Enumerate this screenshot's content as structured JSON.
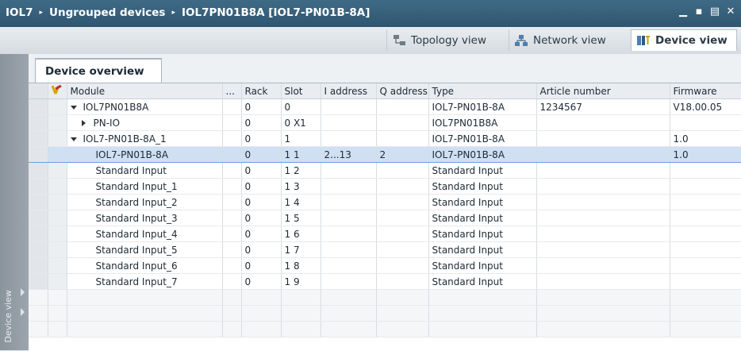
{
  "titlebar": {
    "crumbs": [
      "IOL7",
      "Ungrouped devices",
      "IOL7PN01B8A [IOL7-PN01B-8A]"
    ],
    "separator": "▸"
  },
  "views": {
    "topology": "Topology view",
    "network": "Network view",
    "device": "Device view"
  },
  "sidebar": {
    "label": "Device view"
  },
  "device_overview": {
    "tab_label": "Device overview",
    "columns": [
      "Module",
      "...",
      "Rack",
      "Slot",
      "I address",
      "Q address",
      "Type",
      "Article number",
      "Firmware"
    ],
    "rows": [
      {
        "module": "IOL7PN01B8A",
        "expander": "down",
        "indent": 1,
        "rack": "0",
        "slot": "0",
        "i_address": "",
        "q_address": "",
        "type": "IOL7-PN01B-8A",
        "article": "1234567",
        "firmware": "V18.00.05"
      },
      {
        "module": "PN-IO",
        "expander": "right",
        "indent": 2,
        "rack": "0",
        "slot": "0 X1",
        "i_address": "",
        "q_address": "",
        "type": "IOL7PN01B8A",
        "article": "",
        "firmware": ""
      },
      {
        "module": "IOL7-PN01B-8A_1",
        "expander": "down",
        "indent": 1,
        "rack": "0",
        "slot": "1",
        "i_address": "",
        "q_address": "",
        "type": "IOL7-PN01B-8A",
        "article": "",
        "firmware": "1.0"
      },
      {
        "module": "IOL7-PN01B-8A",
        "expander": "",
        "indent": 3,
        "rack": "0",
        "slot": "1 1",
        "i_address": "2...13",
        "q_address": "2",
        "type": "IOL7-PN01B-8A",
        "article": "",
        "firmware": "1.0",
        "selected": true
      },
      {
        "module": "Standard Input",
        "expander": "",
        "indent": 3,
        "rack": "0",
        "slot": "1 2",
        "i_address": "",
        "q_address": "",
        "type": "Standard Input",
        "article": "",
        "firmware": ""
      },
      {
        "module": "Standard Input_1",
        "expander": "",
        "indent": 3,
        "rack": "0",
        "slot": "1 3",
        "i_address": "",
        "q_address": "",
        "type": "Standard Input",
        "article": "",
        "firmware": ""
      },
      {
        "module": "Standard Input_2",
        "expander": "",
        "indent": 3,
        "rack": "0",
        "slot": "1 4",
        "i_address": "",
        "q_address": "",
        "type": "Standard Input",
        "article": "",
        "firmware": ""
      },
      {
        "module": "Standard Input_3",
        "expander": "",
        "indent": 3,
        "rack": "0",
        "slot": "1 5",
        "i_address": "",
        "q_address": "",
        "type": "Standard Input",
        "article": "",
        "firmware": ""
      },
      {
        "module": "Standard Input_4",
        "expander": "",
        "indent": 3,
        "rack": "0",
        "slot": "1 6",
        "i_address": "",
        "q_address": "",
        "type": "Standard Input",
        "article": "",
        "firmware": ""
      },
      {
        "module": "Standard Input_5",
        "expander": "",
        "indent": 3,
        "rack": "0",
        "slot": "1 7",
        "i_address": "",
        "q_address": "",
        "type": "Standard Input",
        "article": "",
        "firmware": ""
      },
      {
        "module": "Standard Input_6",
        "expander": "",
        "indent": 3,
        "rack": "0",
        "slot": "1 8",
        "i_address": "",
        "q_address": "",
        "type": "Standard Input",
        "article": "",
        "firmware": ""
      },
      {
        "module": "Standard Input_7",
        "expander": "",
        "indent": 3,
        "rack": "0",
        "slot": "1 9",
        "i_address": "",
        "q_address": "",
        "type": "Standard Input",
        "article": "",
        "firmware": ""
      }
    ]
  },
  "colors": {
    "title_bg": "#2f5670",
    "selection": "#cfe0f2",
    "selection_border": "#6f9fd4"
  }
}
